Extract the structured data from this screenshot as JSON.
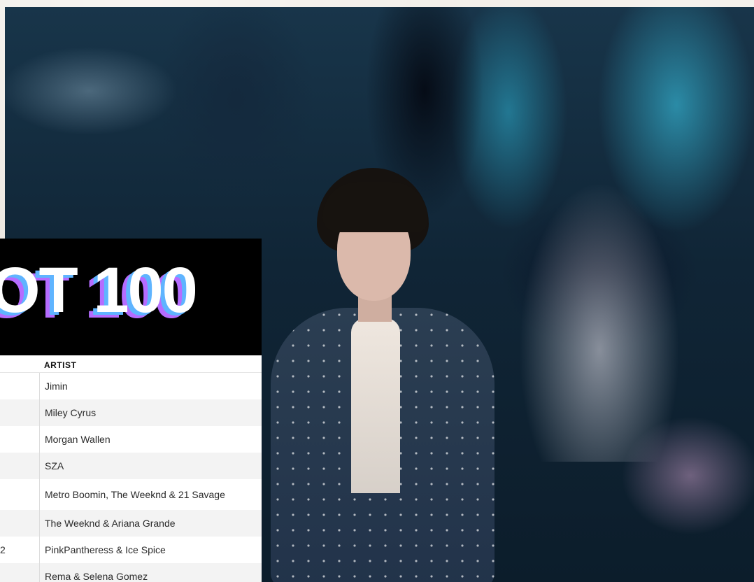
{
  "chart": {
    "logo_text": "OT 100",
    "column_header": "ARTIST",
    "artists": [
      "Jimin",
      "Miley Cyrus",
      "Morgan Wallen",
      "SZA",
      "Metro Boomin, The Weeknd & 21 Savage",
      "The Weeknd & Ariana Grande",
      "PinkPantheress & Ice Spice",
      "Rema & Selena Gomez"
    ],
    "truncated_left_text": "2"
  },
  "colors": {
    "logo_shadow_blue": "#5fb4ff",
    "logo_shadow_purple": "#b56cff",
    "header_bg": "#000000"
  }
}
